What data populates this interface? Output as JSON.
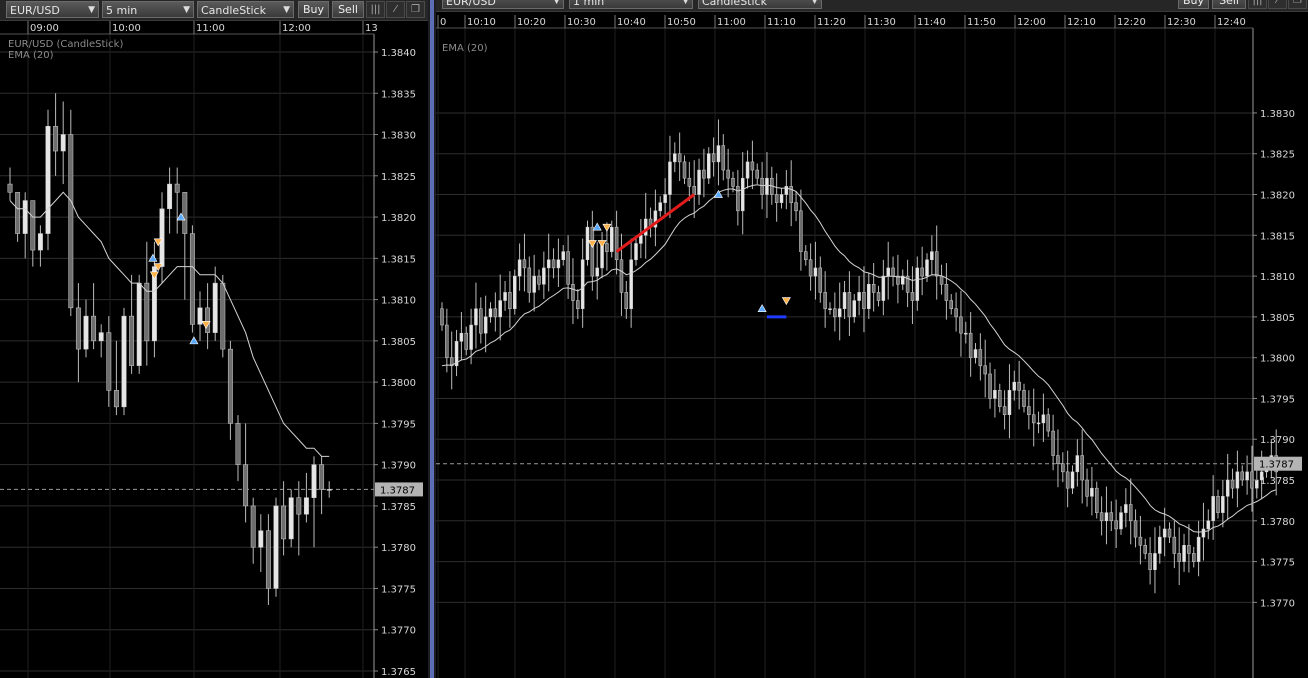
{
  "left_chart": {
    "toolbar": {
      "symbol": "EUR/USD",
      "interval": "5 min",
      "chart_type": "CandleStick",
      "buy_label": "Buy",
      "sell_label": "Sell",
      "icons": [
        "indicator-icon",
        "draw-line-icon",
        "detach-window-icon"
      ]
    },
    "legend_lines": [
      "EUR/USD (CandleStick)",
      "EMA (20)"
    ],
    "time_labels": [
      "09:00",
      "10:00",
      "11:00",
      "12:00",
      "13"
    ],
    "current_price": "1.3787"
  },
  "right_chart": {
    "toolbar": {
      "symbol": "EUR/USD",
      "interval": "1 min",
      "chart_type": "CandleStick",
      "buy_label": "Buy",
      "sell_label": "Sell",
      "icons": [
        "indicator-icon",
        "draw-line-icon",
        "detach-window-icon"
      ]
    },
    "legend_lines": [
      "EMA (20)"
    ],
    "time_labels": [
      "0",
      "10:10",
      "10:20",
      "10:30",
      "10:40",
      "10:50",
      "11:00",
      "11:10",
      "11:20",
      "11:30",
      "11:40",
      "11:50",
      "12:00",
      "12:10",
      "12:20",
      "12:30",
      "12:40"
    ],
    "current_price": "1.3787"
  },
  "colors": {
    "background": "#000000",
    "grid": "#2e2e2e",
    "candle_bull": "#e6e6e6",
    "candle_bear": "#6e6e6e",
    "wick": "#bbbbbb",
    "ema": "#d4d4d4",
    "buy_marker": "#5aa9ff",
    "sell_marker": "#ffb24a",
    "trade_line_red": "#e21b1b",
    "trade_line_blue": "#1f3cff",
    "current_price_tag": "#b4b4b4",
    "separator": "#5e6eb6"
  },
  "chart_data": [
    {
      "type": "candlestick",
      "title": "EUR/USD (CandleStick)",
      "interval": "5 min",
      "y_ticks": [
        "1.3840",
        "1.3835",
        "1.3830",
        "1.3825",
        "1.3820",
        "1.3815",
        "1.3810",
        "1.3805",
        "1.3800",
        "1.3795",
        "1.3790",
        "1.3785",
        "1.3780",
        "1.3775",
        "1.3770",
        "1.3765"
      ],
      "ylim": [
        1.3765,
        1.384
      ],
      "x_ticks": [
        [
          "09:00",
          4
        ],
        [
          "10:00",
          16
        ],
        [
          "11:00",
          28
        ],
        [
          "12:00",
          40
        ]
      ],
      "current_price": 1.3787,
      "candles": [
        [
          1.3824,
          1.3826,
          1.3822,
          1.3823
        ],
        [
          1.3823,
          1.3823,
          1.3817,
          1.3818
        ],
        [
          1.3818,
          1.3823,
          1.3815,
          1.3822
        ],
        [
          1.3822,
          1.3822,
          1.3814,
          1.3816
        ],
        [
          1.3816,
          1.3819,
          1.3814,
          1.3818
        ],
        [
          1.3818,
          1.3833,
          1.3816,
          1.3831
        ],
        [
          1.3831,
          1.3835,
          1.3825,
          1.3828
        ],
        [
          1.3828,
          1.3834,
          1.3824,
          1.383
        ],
        [
          1.383,
          1.3833,
          1.3808,
          1.3809
        ],
        [
          1.3809,
          1.3812,
          1.38,
          1.3804
        ],
        [
          1.3804,
          1.381,
          1.3803,
          1.3808
        ],
        [
          1.3808,
          1.3812,
          1.3804,
          1.3805
        ],
        [
          1.3805,
          1.3807,
          1.3803,
          1.3806
        ],
        [
          1.3806,
          1.3808,
          1.3797,
          1.3799
        ],
        [
          1.3799,
          1.3805,
          1.3796,
          1.3797
        ],
        [
          1.3797,
          1.3809,
          1.3796,
          1.3808
        ],
        [
          1.3808,
          1.3813,
          1.3801,
          1.3802
        ],
        [
          1.3802,
          1.3813,
          1.3801,
          1.3812
        ],
        [
          1.3812,
          1.3817,
          1.3802,
          1.3805
        ],
        [
          1.3805,
          1.3817,
          1.3803,
          1.3814
        ],
        [
          1.3814,
          1.3823,
          1.3812,
          1.3821
        ],
        [
          1.3821,
          1.3826,
          1.3818,
          1.3824
        ],
        [
          1.3824,
          1.3826,
          1.3818,
          1.3823
        ],
        [
          1.3823,
          1.3823,
          1.381,
          1.3818
        ],
        [
          1.3818,
          1.3819,
          1.3806,
          1.3807
        ],
        [
          1.3807,
          1.3811,
          1.3805,
          1.3809
        ],
        [
          1.3809,
          1.3812,
          1.3804,
          1.3806
        ],
        [
          1.3806,
          1.3814,
          1.3805,
          1.3812
        ],
        [
          1.3812,
          1.3813,
          1.3803,
          1.3804
        ],
        [
          1.3804,
          1.3805,
          1.3793,
          1.3795
        ],
        [
          1.3795,
          1.3796,
          1.3788,
          1.379
        ],
        [
          1.379,
          1.3795,
          1.3783,
          1.3785
        ],
        [
          1.3785,
          1.3786,
          1.3778,
          1.378
        ],
        [
          1.378,
          1.3784,
          1.3777,
          1.3782
        ],
        [
          1.3782,
          1.3784,
          1.3773,
          1.3775
        ],
        [
          1.3775,
          1.3786,
          1.3774,
          1.3785
        ],
        [
          1.3785,
          1.3788,
          1.3779,
          1.3781
        ],
        [
          1.3781,
          1.3787,
          1.378,
          1.3786
        ],
        [
          1.3786,
          1.3788,
          1.3779,
          1.3784
        ],
        [
          1.3784,
          1.3789,
          1.3783,
          1.3786
        ],
        [
          1.3786,
          1.3791,
          1.378,
          1.379
        ],
        [
          1.379,
          1.3791,
          1.3784,
          1.3787
        ],
        [
          1.3787,
          1.3788,
          1.3786,
          1.3787
        ]
      ],
      "ema": [
        1.3822,
        1.3821,
        1.3821,
        1.382,
        1.382,
        1.3821,
        1.3822,
        1.3823,
        1.3822,
        1.382,
        1.3819,
        1.3818,
        1.3817,
        1.3815,
        1.3814,
        1.3813,
        1.3812,
        1.3812,
        1.3811,
        1.3811,
        1.3812,
        1.3813,
        1.3814,
        1.3814,
        1.3814,
        1.3813,
        1.3813,
        1.3813,
        1.3812,
        1.381,
        1.3808,
        1.3806,
        1.3803,
        1.3801,
        1.3799,
        1.3797,
        1.3795,
        1.3794,
        1.3793,
        1.3792,
        1.3792,
        1.3791,
        1.3791
      ],
      "buy_markers": [
        [
          18.8,
          1.3815
        ],
        [
          22.5,
          1.382
        ],
        [
          24.2,
          1.3805
        ]
      ],
      "sell_markers": [
        [
          19.0,
          1.3813
        ],
        [
          19.5,
          1.3814
        ],
        [
          19.5,
          1.3817
        ],
        [
          25.8,
          1.3807
        ]
      ]
    },
    {
      "type": "candlestick",
      "title": "EUR/USD 1 min",
      "interval": "1 min",
      "y_ticks": [
        "1.3830",
        "1.3825",
        "1.3820",
        "1.3815",
        "1.3810",
        "1.3805",
        "1.3800",
        "1.3795",
        "1.3790",
        "1.3785",
        "1.3780",
        "1.3775",
        "1.3770"
      ],
      "ylim": [
        1.3766,
        1.3836
      ],
      "x_ticks": [
        [
          "10:10",
          8
        ],
        [
          "10:20",
          18
        ],
        [
          "10:30",
          28
        ],
        [
          "10:40",
          38
        ],
        [
          "10:50",
          48
        ],
        [
          "11:00",
          58
        ],
        [
          "11:10",
          68
        ],
        [
          "11:20",
          78
        ],
        [
          "11:30",
          88
        ],
        [
          "11:40",
          98
        ],
        [
          "11:50",
          108
        ],
        [
          "12:00",
          118
        ],
        [
          "12:10",
          128
        ],
        [
          "12:20",
          138
        ],
        [
          "12:30",
          148
        ],
        [
          "12:40",
          158
        ]
      ],
      "current_price": 1.3787,
      "closes": [
        1.3804,
        1.38,
        1.3799,
        1.3802,
        1.3803,
        1.3801,
        1.3804,
        1.3806,
        1.3803,
        1.3805,
        1.3806,
        1.3805,
        1.3807,
        1.3808,
        1.3806,
        1.381,
        1.3812,
        1.3811,
        1.3808,
        1.381,
        1.3809,
        1.3811,
        1.3812,
        1.3811,
        1.3812,
        1.3813,
        1.3809,
        1.3807,
        1.3806,
        1.3812,
        1.3816,
        1.381,
        1.3811,
        1.3814,
        1.3813,
        1.3816,
        1.3812,
        1.3808,
        1.3806,
        1.3812,
        1.3814,
        1.3815,
        1.3817,
        1.3816,
        1.3818,
        1.3819,
        1.382,
        1.3824,
        1.3825,
        1.3824,
        1.3822,
        1.3821,
        1.382,
        1.3823,
        1.3822,
        1.3825,
        1.3824,
        1.3826,
        1.3823,
        1.3822,
        1.3821,
        1.3818,
        1.3822,
        1.3824,
        1.3823,
        1.3822,
        1.382,
        1.3822,
        1.382,
        1.3819,
        1.382,
        1.3821,
        1.3819,
        1.3818,
        1.3813,
        1.3812,
        1.381,
        1.3811,
        1.3808,
        1.3806,
        1.3806,
        1.3805,
        1.3806,
        1.3808,
        1.3805,
        1.3807,
        1.3808,
        1.3806,
        1.3809,
        1.3808,
        1.3807,
        1.381,
        1.3811,
        1.381,
        1.3809,
        1.381,
        1.3808,
        1.3807,
        1.3811,
        1.381,
        1.3812,
        1.3813,
        1.381,
        1.3809,
        1.3807,
        1.3806,
        1.3805,
        1.3803,
        1.3803,
        1.38,
        1.3801,
        1.3799,
        1.3798,
        1.3795,
        1.3796,
        1.3794,
        1.3793,
        1.3796,
        1.3797,
        1.3796,
        1.3794,
        1.3793,
        1.3792,
        1.3792,
        1.3793,
        1.3791,
        1.3788,
        1.3787,
        1.3786,
        1.3784,
        1.3786,
        1.3788,
        1.3785,
        1.3783,
        1.3784,
        1.3781,
        1.378,
        1.3781,
        1.378,
        1.3779,
        1.3781,
        1.3782,
        1.378,
        1.3778,
        1.3777,
        1.3776,
        1.3774,
        1.3776,
        1.3778,
        1.3779,
        1.3778,
        1.3776,
        1.3775,
        1.3777,
        1.3776,
        1.3775,
        1.3778,
        1.3779,
        1.378,
        1.3783,
        1.3781,
        1.3783,
        1.3785,
        1.3784,
        1.3786,
        1.3785,
        1.3786,
        1.3784,
        1.3785,
        1.3786,
        1.3787,
        1.3788,
        1.3786
      ],
      "ema_label": "EMA (20)",
      "buy_markers": [
        [
          32,
          1.3816
        ],
        [
          57,
          1.382
        ],
        [
          66,
          1.3806
        ]
      ],
      "sell_markers": [
        [
          31,
          1.3814
        ],
        [
          33,
          1.3814
        ],
        [
          34,
          1.3816
        ],
        [
          71,
          1.3807
        ]
      ],
      "trade_lines": [
        {
          "color": "red",
          "from": [
            36,
            1.3813
          ],
          "to": [
            52,
            1.382
          ]
        },
        {
          "color": "blue",
          "from": [
            67,
            1.3805
          ],
          "to": [
            71,
            1.3805
          ]
        }
      ]
    }
  ]
}
